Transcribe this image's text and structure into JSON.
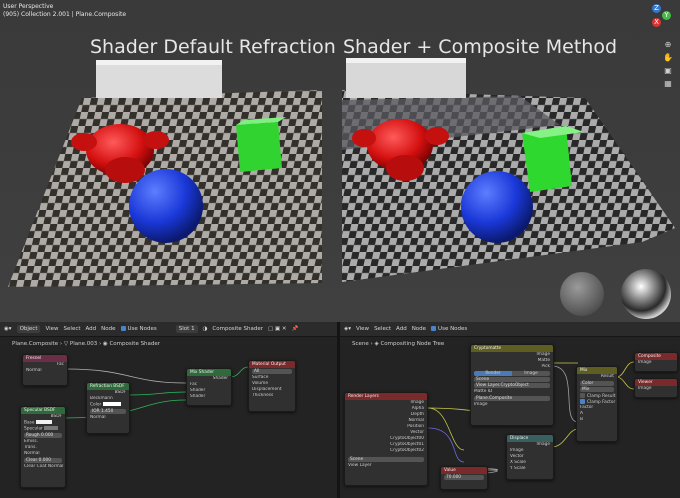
{
  "viewport": {
    "info_line1": "User Perspective",
    "info_line2": "(905) Collection 2.001 | Plane.Composite",
    "title_left": "Shader Default Refraction",
    "title_right": "Shader + Composite Method",
    "axis": {
      "z": "Z",
      "y": "Y",
      "x": "X"
    },
    "colors": {
      "monkey": "#d41010",
      "cube": "#2fd82f",
      "sphere": "#1a38d8",
      "x_axis": "#d33",
      "y_axis": "#4b4",
      "z_axis": "#37c"
    }
  },
  "shader_editor": {
    "header": {
      "mode": "Object",
      "menus": [
        "View",
        "Select",
        "Add",
        "Node"
      ],
      "use_nodes": "Use Nodes",
      "slot": "Slot 1",
      "material": "Composite Shader"
    },
    "breadcrumb": [
      "Plane.Composite",
      "Plane.003",
      "Composite Shader"
    ],
    "nodes": {
      "fresnel": {
        "title": "Fresnel",
        "out": "Fac",
        "in": "Normal"
      },
      "refraction": {
        "title": "Refraction BSDF",
        "out": "BSDF",
        "f1": "Beckmann",
        "f2": "Color",
        "f3": "IOR",
        "f3v": "1.450",
        "f4": "Normal"
      },
      "mix": {
        "title": "Mix Shader",
        "out": "Shader",
        "in1": "Fac",
        "in2": "Shader",
        "in3": "Shader"
      },
      "output": {
        "title": "Material Output",
        "sel": "All",
        "in1": "Surface",
        "in2": "Volume",
        "in3": "Displacement",
        "in4": "Thickness"
      },
      "specular": {
        "title": "Specular BSDF",
        "out": "BSDF",
        "f1": "Base",
        "f2": "Specular",
        "f3": "Rough",
        "f3v": "0.000",
        "f4": "Emiss.",
        "f5": "Trans.",
        "f6": "Normal",
        "f7": "Clear",
        "f7v": "0.000",
        "f8": "Clear Coat Normal"
      }
    }
  },
  "compositor": {
    "header": {
      "menus": [
        "View",
        "Select",
        "Add",
        "Node"
      ],
      "use_nodes": "Use Nodes"
    },
    "breadcrumb": [
      "Scene",
      "Compositing Node Tree"
    ],
    "nodes": {
      "render_layers": {
        "title": "Render Layers",
        "outs": [
          "Image",
          "Alpha",
          "Depth",
          "Normal",
          "Position",
          "Vector",
          "CryptoObject00",
          "CryptoObject01",
          "CryptoObject02"
        ],
        "scene": "Scene",
        "view_layer": "View Layer"
      },
      "cryptomatte": {
        "title": "Cryptomatte",
        "outs": [
          "Image",
          "Matte",
          "Pick"
        ],
        "tab1": "Render",
        "tab2": "Image",
        "scene": "Scene",
        "layer": "View Layer.CryptoObject",
        "matte_id": "Matte ID",
        "matte_val": "Plane.Composite",
        "in": "Image"
      },
      "displace": {
        "title": "Displace",
        "out": "Image",
        "ins": [
          "Image",
          "Vector",
          "X Scale",
          "Y Scale"
        ]
      },
      "value": {
        "title": "Value",
        "out": "Value",
        "val": "70.000"
      },
      "mix": {
        "title": "Mix",
        "out": "Result",
        "type": "Color",
        "blend": "Mix",
        "clamp1": "Clamp Result",
        "clamp2": "Clamp Factor",
        "ins": [
          "Factor",
          "A",
          "B"
        ]
      },
      "composite": {
        "title": "Composite",
        "in": "Image"
      },
      "viewer": {
        "title": "Viewer",
        "in": "Image"
      }
    }
  }
}
